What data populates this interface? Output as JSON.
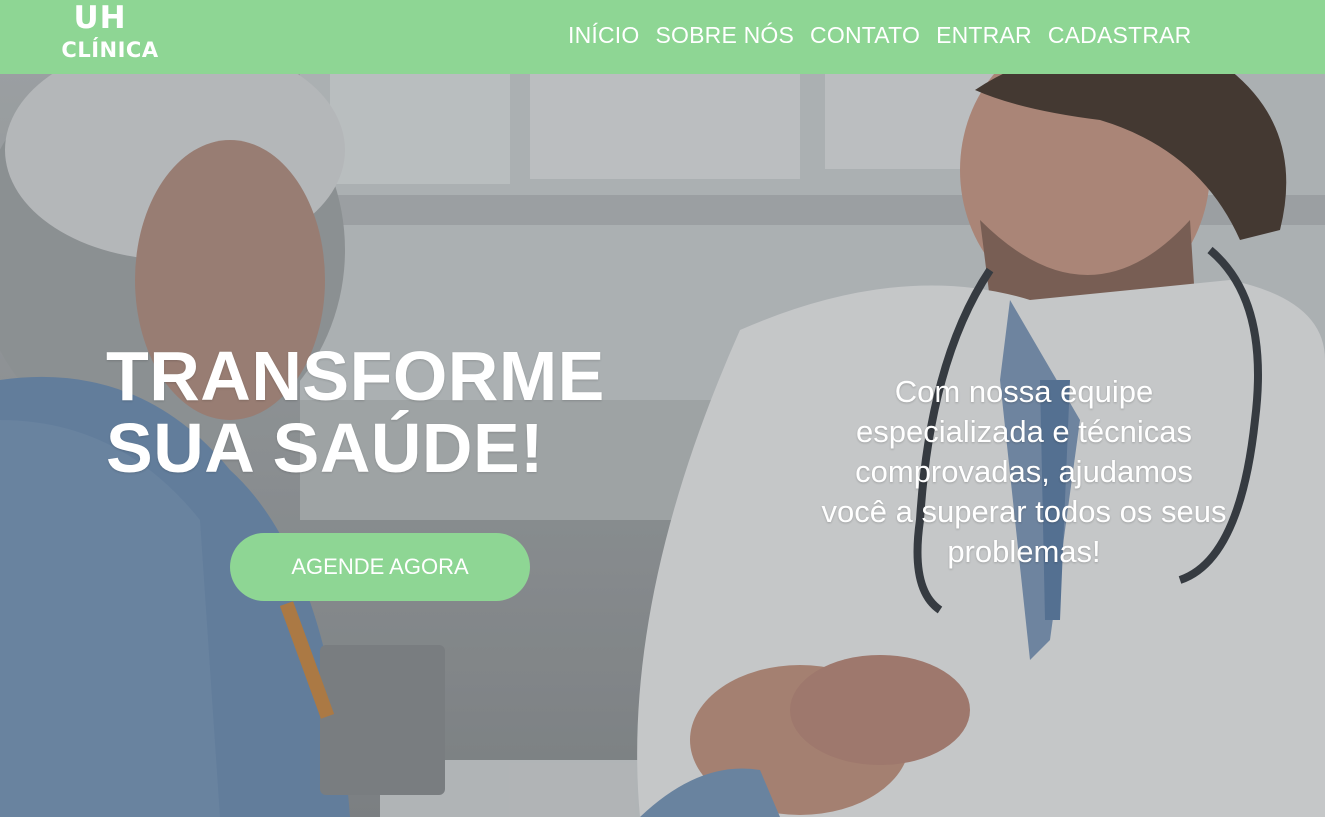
{
  "header": {
    "logo": {
      "line1": "UH",
      "line2": "CLÍNICA"
    },
    "nav": [
      "INÍCIO",
      "SOBRE NÓS",
      "CONTATO",
      "ENTRAR",
      "CADASTRAR"
    ]
  },
  "hero": {
    "headline_line1": "TRANSFORME",
    "headline_line2": "SUA SAÚDE!",
    "cta_label": "AGENDE AGORA",
    "description": "Com nossa equipe especializada e técnicas comprovadas, ajudamos você a superar todos os seus problemas!"
  },
  "colors": {
    "accent": "#8ed694",
    "text": "#ffffff"
  }
}
